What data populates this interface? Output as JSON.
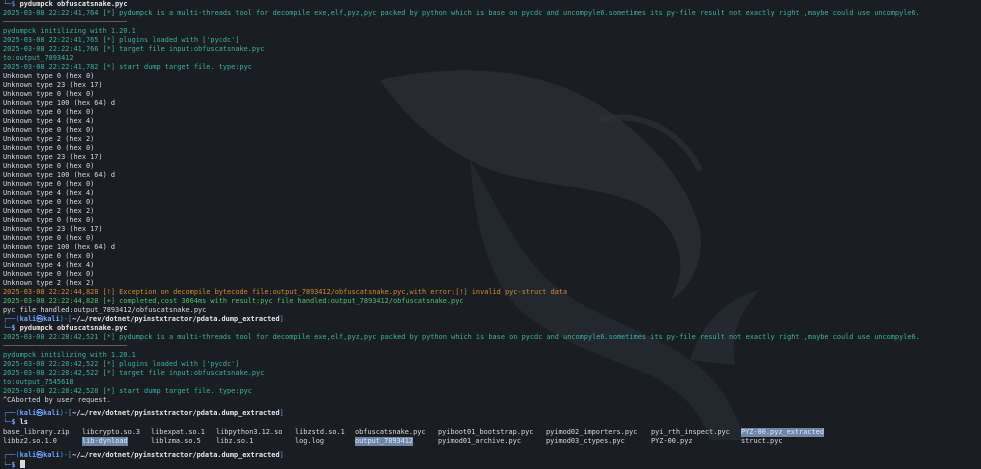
{
  "cmd1": {
    "prompt_tail": "└─$ ",
    "command": "pydumpck obfuscatsnake.pyc"
  },
  "run1": {
    "intro": "2025-03-08 22:22:41,764 [*] pydumpck is a multi-threads tool for decompile exe,elf,pyz,pyc packed by python which is base on pycdc and uncompyle6.sometimes its py-file result not exactly right ,maybe could use uncompyle6.",
    "init": "pydumpck initilizing with 1.20.1",
    "plugins": "2025-03-08 22:22:41,765 [*] plugins loaded with ['pycdc']",
    "target": "2025-03-08 22:22:41,766 [*] target file input:obfuscatsnake.pyc",
    "output": "to:output_7893412",
    "start": "2025-03-08 22:22:41,782 [*] start dump target file. type:pyc",
    "unknown": [
      "Unknown type 0 (hex 0)",
      "Unknown type 23 (hex 17)",
      "Unknown type 0 (hex 0)",
      "Unknown type 100 (hex 64) d",
      "Unknown type 0 (hex 0)",
      "Unknown type 4 (hex 4)",
      "Unknown type 0 (hex 0)",
      "Unknown type 2 (hex 2)",
      "Unknown type 0 (hex 0)",
      "Unknown type 23 (hex 17)",
      "Unknown type 0 (hex 0)",
      "Unknown type 100 (hex 64) d",
      "Unknown type 0 (hex 0)",
      "Unknown type 4 (hex 4)",
      "Unknown type 0 (hex 0)",
      "Unknown type 2 (hex 2)",
      "Unknown type 0 (hex 0)",
      "Unknown type 23 (hex 17)",
      "Unknown type 0 (hex 0)",
      "Unknown type 100 (hex 64) d",
      "Unknown type 0 (hex 0)",
      "Unknown type 4 (hex 4)",
      "Unknown type 0 (hex 0)",
      "Unknown type 2 (hex 2)"
    ],
    "exception": "2025-03-08 22:22:44,828 [!] Exception on decompile bytecode file:output_7893412/obfuscatsnake.pyc,with error:[!] invalid pyc-struct data",
    "completed": "2025-03-08 22:22:44,828 [+] completed,cost 3064ms with result:pyc file handled:output_7893412/obfuscatsnake.pyc",
    "handled": "pyc file handled:output_7893412/obfuscatsnake.pyc"
  },
  "prompt": {
    "top_open": "┌──(",
    "user": "kali",
    "at": "㉿",
    "host": "kali",
    "top_mid": ")-[",
    "path": "~/…/rev/dotnet/pyinstxtractor/pdata.dump_extracted",
    "top_close": "]",
    "bottom": "└─",
    "dollar": "$ "
  },
  "cmd2": {
    "command": "pydumpck obfuscatsnake.pyc"
  },
  "run2": {
    "intro": "2025-03-08 22:28:42,521 [*] pydumpck is a multi-threads tool for decompile exe,elf,pyz,pyc packed by python which is base on pycdc and uncompyle6.sometimes its py-file result not exactly right ,maybe could use uncompyle6.",
    "init": "pydumpck initilizing with 1.20.1",
    "plugins": "2025-03-08 22:28:42,522 [*] plugins loaded with ['pycdc']",
    "target": "2025-03-08 22:28:42,522 [*] target file input:obfuscatsnake.pyc",
    "output": "to:output_7545618",
    "start": "2025-03-08 22:28:42,528 [*] start dump target file. type:pyc",
    "abort": "^CAborted by user request."
  },
  "cmd3": {
    "command": "ls"
  },
  "ls_row1": [
    {
      "text": "base_library.zip",
      "kind": "plain"
    },
    {
      "text": "libcrypto.so.3",
      "kind": "plain"
    },
    {
      "text": "libexpat.so.1",
      "kind": "plain"
    },
    {
      "text": "libpython3.12.so",
      "kind": "plain"
    },
    {
      "text": "libzstd.so.1",
      "kind": "plain"
    },
    {
      "text": "obfuscatsnake.pyc",
      "kind": "plain"
    },
    {
      "text": "pyiboot01_bootstrap.pyc",
      "kind": "plain"
    },
    {
      "text": "pyimod02_importers.pyc",
      "kind": "plain"
    },
    {
      "text": "pyi_rth_inspect.pyc",
      "kind": "plain"
    },
    {
      "text": "PYZ-00.pyz_extracted",
      "kind": "dir"
    }
  ],
  "ls_row2": [
    {
      "text": "libbz2.so.1.0",
      "kind": "plain"
    },
    {
      "text": "lib-dynload",
      "kind": "dir"
    },
    {
      "text": "liblzma.so.5",
      "kind": "plain"
    },
    {
      "text": "libz.so.1",
      "kind": "plain"
    },
    {
      "text": "log.log",
      "kind": "plain"
    },
    {
      "text": "output_7893412",
      "kind": "dir"
    },
    {
      "text": "pyimod01_archive.pyc",
      "kind": "plain"
    },
    {
      "text": "pyimod03_ctypes.pyc",
      "kind": "plain"
    },
    {
      "text": "PYZ-00.pyz",
      "kind": "plain"
    },
    {
      "text": "struct.pyc",
      "kind": "plain"
    }
  ],
  "colors": {
    "background": "#1a1d22",
    "log_teal": "#37b3a3",
    "prompt_blue": "#5f9bf2",
    "warning_orange": "#d18b2a",
    "success_green": "#4ec16c"
  }
}
